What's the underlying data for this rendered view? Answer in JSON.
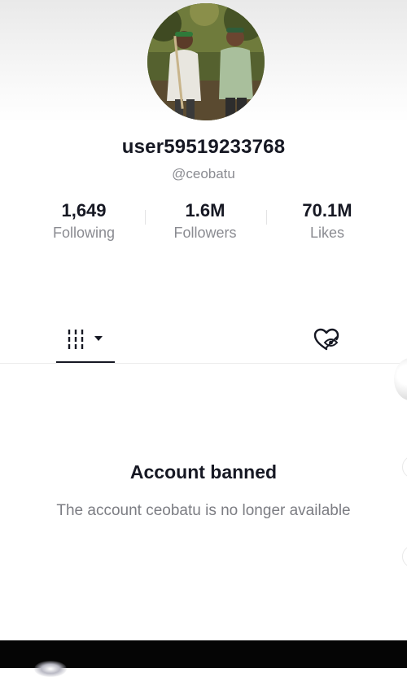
{
  "profile": {
    "username": "user59519233768",
    "handle": "@ceobatu"
  },
  "stats": {
    "following": {
      "value": "1,649",
      "label": "Following"
    },
    "followers": {
      "value": "1.6M",
      "label": "Followers"
    },
    "likes": {
      "value": "70.1M",
      "label": "Likes"
    }
  },
  "tabs": {
    "videos_icon": "grid-columns-icon",
    "liked_icon": "liked-hidden-heart-icon"
  },
  "empty_state": {
    "title": "Account banned",
    "description": "The account ceobatu is no longer available"
  }
}
